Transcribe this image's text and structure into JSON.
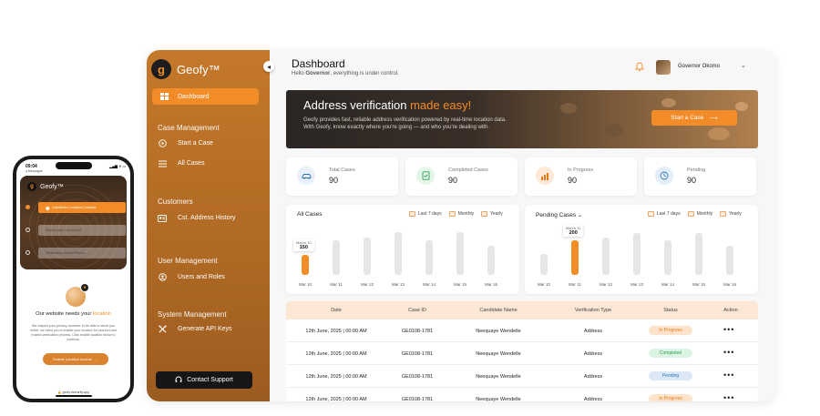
{
  "sidebar": {
    "brand": "Geofy™",
    "logo_glyph": "g",
    "active_item": {
      "label": "Dashboard",
      "icon": "dashboard-icon"
    },
    "sections": [
      {
        "title": "Case Management",
        "items": [
          {
            "label": "Start a Case",
            "icon": "play-circle-icon"
          },
          {
            "label": "All Cases",
            "icon": "list-icon"
          }
        ]
      },
      {
        "title": "Customers",
        "items": [
          {
            "label": "Cst. Address History",
            "icon": "id-card-icon"
          }
        ]
      },
      {
        "title": "User Management",
        "items": [
          {
            "label": "Users and Roles",
            "icon": "user-circle-icon"
          }
        ]
      },
      {
        "title": "System Management",
        "items": [
          {
            "label": "Generate API Keys",
            "icon": "tools-icon"
          }
        ]
      }
    ],
    "support_button": "Contact Support"
  },
  "header": {
    "title": "Dashboard",
    "greeting_prefix": "Hello ",
    "greeting_name": "Governor",
    "greeting_suffix": ", everything is under control.",
    "user_name": "Governor Okomo"
  },
  "banner": {
    "title_main": "Address verification ",
    "title_accent": "made easy!",
    "text": "Geofy provides fast, reliable address verification powered by real-time location data. With Geofy, know exactly where you're going — and who you're dealing with.",
    "button": "Start a Case"
  },
  "stats": [
    {
      "label": "Total Cases",
      "value": "90",
      "icon": "car-icon",
      "color": "#e7f0fb",
      "icon_color": "#2f6fb5"
    },
    {
      "label": "Completed Cases",
      "value": "90",
      "icon": "check-doc-icon",
      "color": "#e3f6e8",
      "icon_color": "#2e9b55"
    },
    {
      "label": "In Progress",
      "value": "90",
      "icon": "bar-chart-icon",
      "color": "#fde9d6",
      "icon_color": "#e27b14"
    },
    {
      "label": "Pending",
      "value": "90",
      "icon": "clock-icon",
      "color": "#e3eefa",
      "icon_color": "#2f76b6"
    }
  ],
  "filters": [
    "Last 7 days",
    "Monthly",
    "Yearly"
  ],
  "chart_data": [
    {
      "type": "bar",
      "title": "All Cases",
      "categories": [
        "Mar 10",
        "Mar 11",
        "Mar 12",
        "Mar 13",
        "Mar 14",
        "Mar 15",
        "Mar 16"
      ],
      "values": [
        150,
        260,
        280,
        320,
        260,
        320,
        220
      ],
      "highlight_index": 0,
      "tooltip": {
        "label": "March 10",
        "value": "150"
      },
      "ylim": [
        0,
        340
      ]
    },
    {
      "type": "bar",
      "title": "Pending Cases",
      "categories": [
        "Mar 10",
        "Mar 11",
        "Mar 12",
        "Mar 13",
        "Mar 14",
        "Mar 15",
        "Mar 16"
      ],
      "values": [
        120,
        200,
        215,
        240,
        200,
        240,
        165
      ],
      "highlight_index": 1,
      "tooltip": {
        "label": "March 11",
        "value": "200"
      },
      "ylim": [
        0,
        260
      ]
    }
  ],
  "table": {
    "columns": [
      "Date",
      "Case ID",
      "Candidate Name",
      "Verification Type",
      "Status",
      "Action"
    ],
    "rows": [
      {
        "date": "12th June, 2025 | 00:00 AM",
        "case_id": "GE0108-1781",
        "name": "Neequaye Wendelle",
        "type": "Address",
        "status": "In Progress",
        "status_kind": "prog"
      },
      {
        "date": "12th June, 2025 | 00:00 AM",
        "case_id": "GE0108-1781",
        "name": "Neequaye Wendelle",
        "type": "Address",
        "status": "Completed",
        "status_kind": "comp"
      },
      {
        "date": "12th June, 2025 | 00:00 AM",
        "case_id": "GE0108-1781",
        "name": "Neequaye Wendelle",
        "type": "Address",
        "status": "Pending",
        "status_kind": "pend"
      },
      {
        "date": "12th June, 2025 | 00:00 AM",
        "case_id": "GE0108-1781",
        "name": "Neequaye Wendelle",
        "type": "Address",
        "status": "In Progress",
        "status_kind": "prog"
      }
    ],
    "action_label": "•••"
  },
  "phone": {
    "time": "09:04",
    "back_label": "◂ Messages",
    "status_icons": "▂▄▆ ≋ ▭",
    "brand": "Geofy™",
    "fields": [
      {
        "label": "Candidate Location Consent",
        "state": "active"
      },
      {
        "label": "Submit your Document",
        "state": "dim"
      },
      {
        "label": "Verification Status/Report",
        "state": "dim"
      }
    ],
    "heading_main": "Our website needs your ",
    "heading_accent": "location",
    "body": "We respect your privacy, however to be able to serve you better, we need you to enable your location for secured and trusted verification process. Click enable location below to continue.",
    "button": "Enable Location Access",
    "url": "🔒 geofy.riverarity.app"
  }
}
